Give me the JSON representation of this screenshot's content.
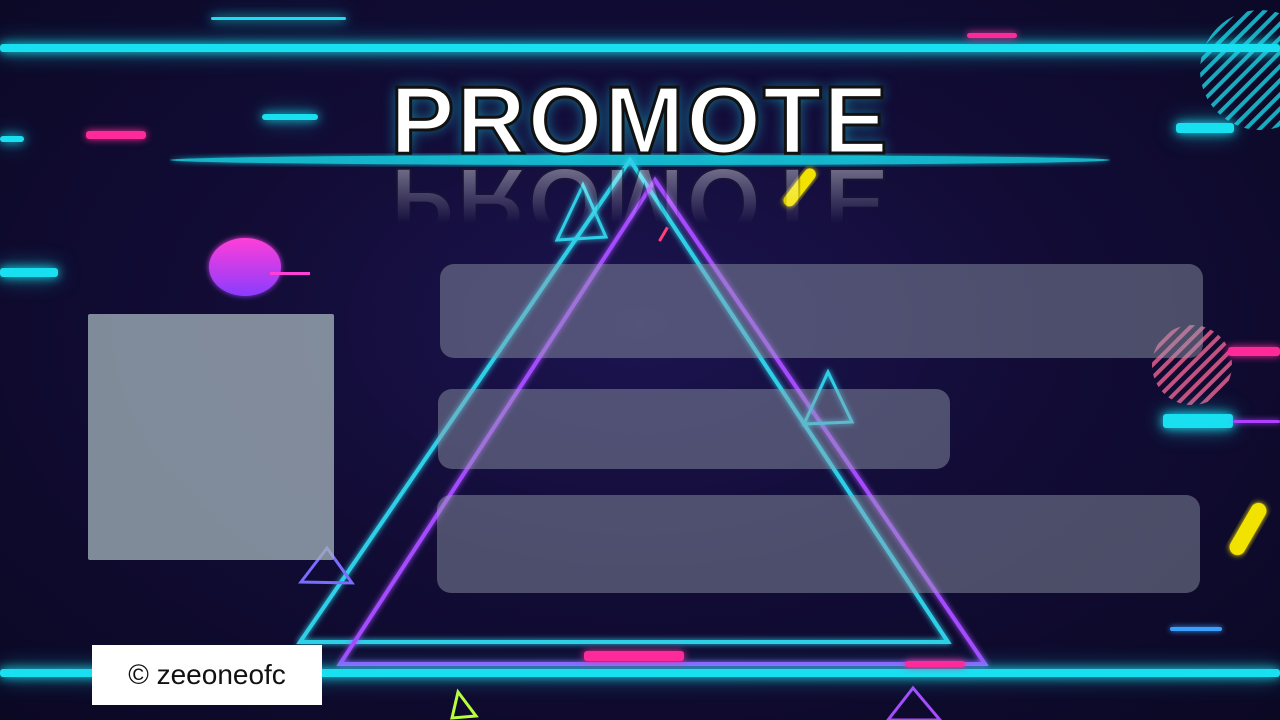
{
  "banner": {
    "title": "PROMOTE",
    "watermark": "© zeeoneofc"
  },
  "colors": {
    "background": "#120c36",
    "neon_cyan": "#19e0f0",
    "neon_pink": "#ff2a9a",
    "neon_violet": "#b040ff",
    "accent_yellow": "#f2e200",
    "placeholder_fill": "#96a0af"
  },
  "placeholders": {
    "image_box": "image-placeholder",
    "text_bars": [
      "text-bar-1",
      "text-bar-2",
      "text-bar-3"
    ]
  }
}
